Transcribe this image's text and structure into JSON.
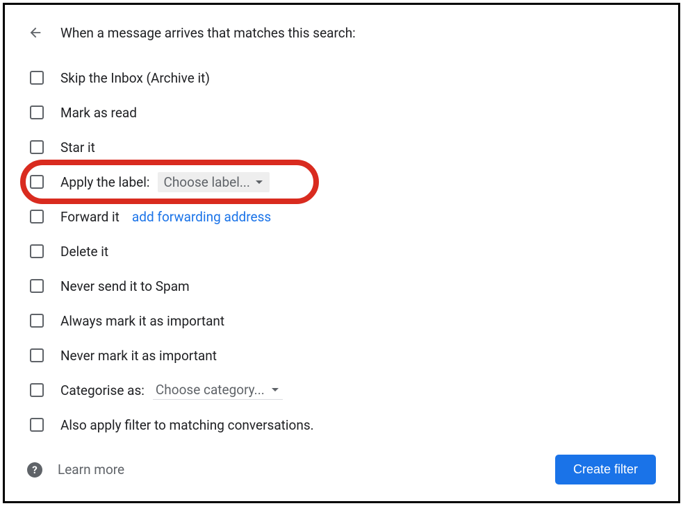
{
  "header": {
    "title": "When a message arrives that matches this search:"
  },
  "options": {
    "skip_inbox": "Skip the Inbox (Archive it)",
    "mark_read": "Mark as read",
    "star_it": "Star it",
    "apply_label": "Apply the label:",
    "apply_label_dropdown": "Choose label...",
    "forward_it": "Forward it",
    "forward_link": "add forwarding address",
    "delete_it": "Delete it",
    "never_spam": "Never send it to Spam",
    "always_important": "Always mark it as important",
    "never_important": "Never mark it as important",
    "categorise": "Categorise as:",
    "categorise_dropdown": "Choose category...",
    "also_apply": "Also apply filter to matching conversations."
  },
  "footer": {
    "help_glyph": "?",
    "learn_more": "Learn more",
    "create_button": "Create filter"
  }
}
